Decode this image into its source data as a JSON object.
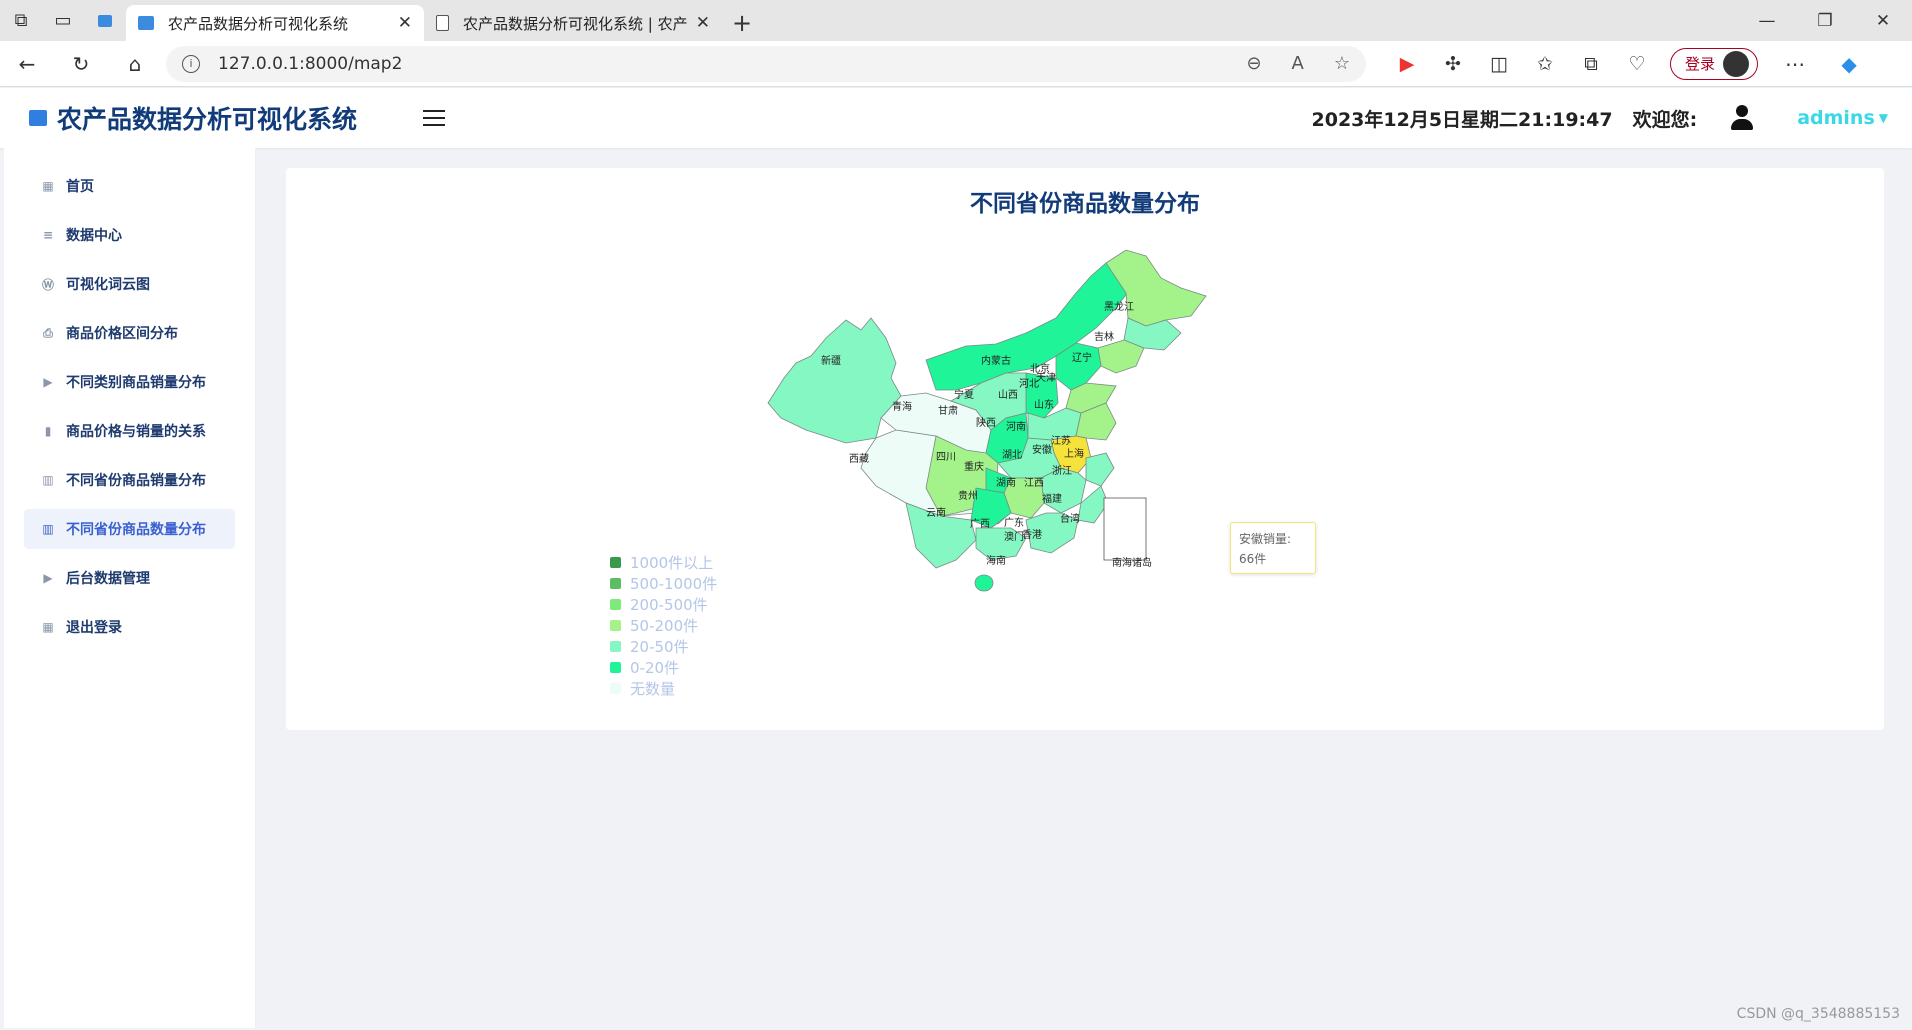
{
  "browser": {
    "tabs": [
      {
        "title": "农产品数据分析可视化系统"
      },
      {
        "title": "农产品数据分析可视化系统 | 农产"
      }
    ],
    "url": "127.0.0.1:8000/map2",
    "login_label": "登录"
  },
  "header": {
    "title": "农产品数据分析可视化系统",
    "datetime": "2023年12月5日星期二21:19:47",
    "welcome": "欢迎您:",
    "username": "admins"
  },
  "sidebar": {
    "items": [
      {
        "label": "首页",
        "icon": "grid-icon"
      },
      {
        "label": "数据中心",
        "icon": "database-icon"
      },
      {
        "label": "可视化词云图",
        "icon": "wordpress-icon"
      },
      {
        "label": "商品价格区间分布",
        "icon": "printer-icon"
      },
      {
        "label": "不同类别商品销量分布",
        "icon": "play-icon"
      },
      {
        "label": "商品价格与销量的关系",
        "icon": "bar-chart-icon"
      },
      {
        "label": "不同省份商品销量分布",
        "icon": "map-icon"
      },
      {
        "label": "不同省份商品数量分布",
        "icon": "map-filled-icon",
        "active": true
      },
      {
        "label": "后台数据管理",
        "icon": "play-icon"
      },
      {
        "label": "退出登录",
        "icon": "grid-icon"
      }
    ]
  },
  "main": {
    "title": "不同省份商品数量分布",
    "legend": [
      {
        "label": "1000件以上",
        "color": "#3a9a4c"
      },
      {
        "label": "500-1000件",
        "color": "#5cbd62"
      },
      {
        "label": "200-500件",
        "color": "#7eea7a"
      },
      {
        "label": "50-200件",
        "color": "#a4f28a"
      },
      {
        "label": "20-50件",
        "color": "#84f7c2"
      },
      {
        "label": "0-20件",
        "color": "#1ff598"
      },
      {
        "label": "无数量",
        "color": "#eefcf8"
      }
    ],
    "map_labels": [
      "黑龙江",
      "吉林",
      "辽宁",
      "内蒙古",
      "北京",
      "天津",
      "河北",
      "山西",
      "宁夏",
      "新疆",
      "青海",
      "甘肃",
      "陕西",
      "河南",
      "山东",
      "江苏",
      "安徽",
      "上海",
      "浙江",
      "湖北",
      "西藏",
      "四川",
      "重庆",
      "湖南",
      "江西",
      "贵州",
      "福建",
      "云南",
      "广西",
      "广东",
      "台湾",
      "澳门",
      "香港",
      "海南",
      "南海诸岛"
    ],
    "tooltip": {
      "title": "安徽销量:",
      "value": "66件"
    }
  },
  "watermark": "CSDN @q_3548885153"
}
